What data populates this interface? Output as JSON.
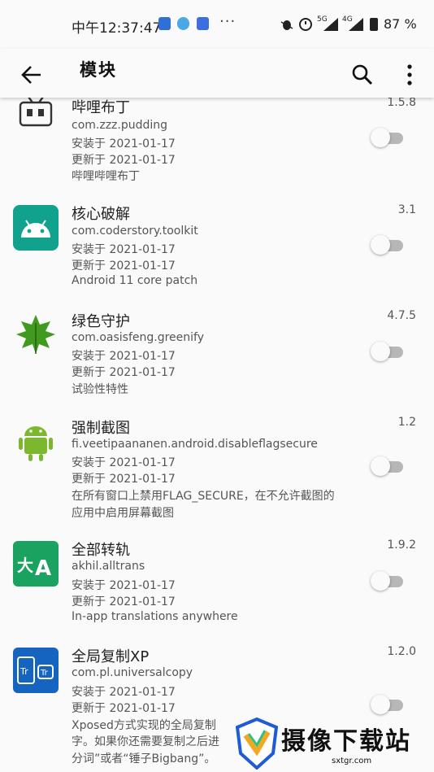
{
  "status_bar": {
    "time": "中午12:37:47",
    "dots": "···",
    "signal_1": "5G",
    "signal_2": "4G",
    "battery": "87 %"
  },
  "app_bar": {
    "title": "模块",
    "back_icon": "arrow-back-icon",
    "search_icon": "search-icon",
    "more_icon": "more-vert-icon"
  },
  "modules": [
    {
      "name": "哔哩布丁",
      "package": "com.zzz.pudding",
      "installed": "安装于 2021-01-17",
      "updated": "更新于 2021-01-17",
      "description": "哔哩哔哩布丁",
      "version": "1.5.8",
      "icon": "bilibili-tv-icon",
      "enabled": false
    },
    {
      "name": "核心破解",
      "package": "com.coderstory.toolkit",
      "installed": "安装于 2021-01-17",
      "updated": "更新于 2021-01-17",
      "description": "Android 11 core patch",
      "version": "3.1",
      "icon": "android-head-icon",
      "enabled": false
    },
    {
      "name": "绿色守护",
      "package": "com.oasisfeng.greenify",
      "installed": "安装于 2021-01-17",
      "updated": "更新于 2021-01-17",
      "description": "试验性特性",
      "version": "4.7.5",
      "icon": "green-leaf-icon",
      "enabled": false
    },
    {
      "name": "强制截图",
      "package": "fi.veetipaananen.android.disableflagsecure",
      "installed": "安装于 2021-01-17",
      "updated": "更新于 2021-01-17",
      "description": "在所有窗口上禁用FLAG_SECURE，在不允许截图的",
      "description_2": "应用中启用屏幕截图",
      "version": "1.2",
      "icon": "android-robot-icon",
      "enabled": false
    },
    {
      "name": "全部转轨",
      "package": "akhil.alltrans",
      "installed": "安装于 2021-01-17",
      "updated": "更新于 2021-01-17",
      "description": "In-app translations anywhere",
      "version": "1.9.2",
      "icon": "translate-icon",
      "enabled": false
    },
    {
      "name": "全局复制XP",
      "package": "com.pl.universalcopy",
      "installed": "安装于 2021-01-17",
      "updated": "更新于 2021-01-17",
      "description": "Xposed方式实现的全局复制",
      "description_2": "字。如果你还需要复制之后进",
      "description_3": "分词”或者“锤子Bigbang”。",
      "version": "1.2.0",
      "icon": "universal-copy-icon",
      "enabled": false
    }
  ],
  "watermark": {
    "text": "摄像下载站",
    "url": "sxtgr.com"
  },
  "colors": {
    "background": "#fafafa",
    "toggle_track_off": "#b7b7b7",
    "android_green": "#3ddc84",
    "translate_green": "#1aa260",
    "copy_blue": "#1565c0"
  }
}
